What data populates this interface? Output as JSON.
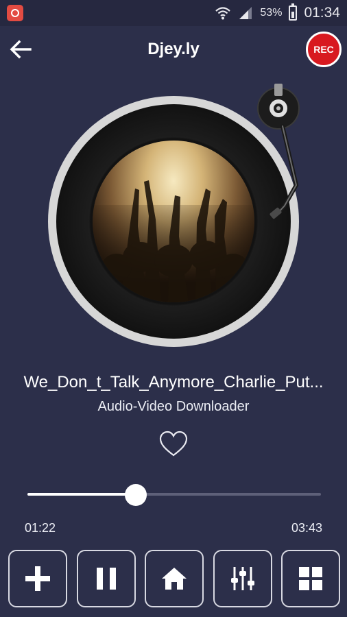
{
  "status_bar": {
    "battery_percent": "53%",
    "time": "01:34"
  },
  "app_bar": {
    "title": "Djey.ly",
    "rec_label": "REC"
  },
  "player": {
    "track_title": "We_Don_t_Talk_Anymore_Charlie_Put...",
    "track_subtitle": "Audio-Video Downloader",
    "current_time": "01:22",
    "total_time": "03:43",
    "progress": 0.37
  },
  "controls": {
    "buttons": [
      "add-icon",
      "pause-icon",
      "home-icon",
      "equalizer-icon",
      "grid-icon"
    ]
  },
  "colors": {
    "background": "#2c2f4a",
    "rec": "#d8191f"
  }
}
